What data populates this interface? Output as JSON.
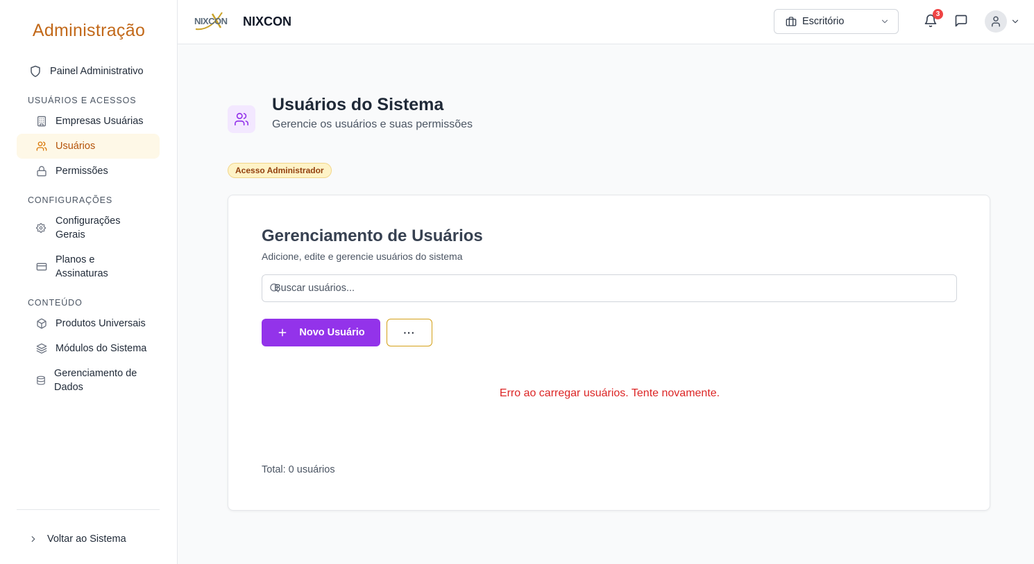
{
  "sidebar": {
    "title": "Administração",
    "dashboard": "Painel Administrativo",
    "sections": {
      "users_access": "USUÁRIOS E ACESSOS",
      "settings": "CONFIGURAÇÕES",
      "content": "CONTEÚDO"
    },
    "items": {
      "companies": "Empresas Usuárias",
      "users": "Usuários",
      "permissions": "Permissões",
      "general_settings_1": "Configurações",
      "general_settings_2": "Gerais",
      "plans_1": "Planos e",
      "plans_2": "Assinaturas",
      "universal_products": "Produtos Universais",
      "system_modules": "Módulos do Sistema",
      "data_management_1": "Gerenciamento de",
      "data_management_2": "Dados"
    },
    "back": "Voltar ao Sistema",
    "active_item": "users"
  },
  "header": {
    "logo_text": "NIXCON",
    "brand_name": "NIXCON",
    "office_select": "Escritório",
    "notification_count": "3"
  },
  "page": {
    "title": "Usuários do Sistema",
    "subtitle": "Gerencie os usuários e suas permissões",
    "admin_badge": "Acesso Administrador"
  },
  "card": {
    "title": "Gerenciamento de Usuários",
    "subtitle": "Adicione, edite e gerencie usuários do sistema",
    "search_placeholder": "Buscar usuários...",
    "new_user_label": "Novo Usuário",
    "more_label": "···",
    "error_message": "Erro ao carregar usuários. Tente novamente.",
    "total": "Total: 0 usuários"
  },
  "colors": {
    "accent": "#9333ea",
    "brand_orange": "#c2691a",
    "active_bg": "#fef8e7",
    "error": "#dc2626"
  }
}
